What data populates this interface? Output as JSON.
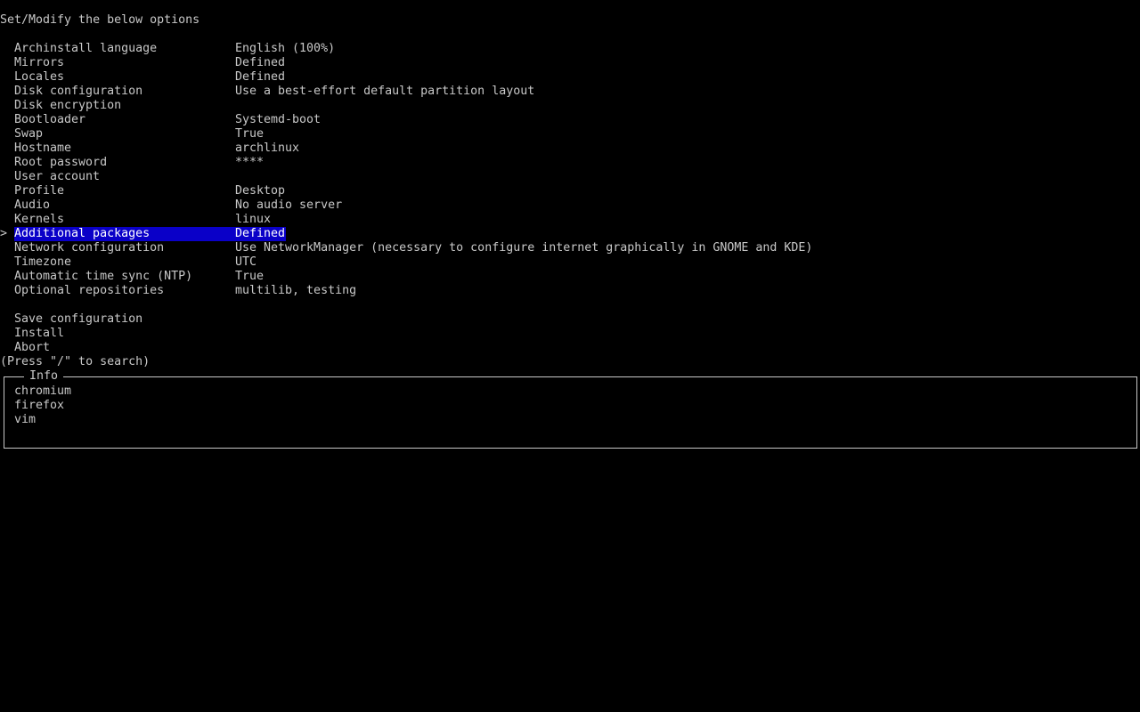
{
  "header": {
    "title": "Set/Modify the below options"
  },
  "menu": {
    "caret": ">",
    "items": [
      {
        "label": "Archinstall language",
        "value": "English (100%)"
      },
      {
        "label": "Mirrors",
        "value": "Defined"
      },
      {
        "label": "Locales",
        "value": "Defined"
      },
      {
        "label": "Disk configuration",
        "value": "Use a best-effort default partition layout"
      },
      {
        "label": "Disk encryption",
        "value": ""
      },
      {
        "label": "Bootloader",
        "value": "Systemd-boot"
      },
      {
        "label": "Swap",
        "value": "True"
      },
      {
        "label": "Hostname",
        "value": "archlinux"
      },
      {
        "label": "Root password",
        "value": "****"
      },
      {
        "label": "User account",
        "value": ""
      },
      {
        "label": "Profile",
        "value": "Desktop"
      },
      {
        "label": "Audio",
        "value": "No audio server"
      },
      {
        "label": "Kernels",
        "value": "linux"
      },
      {
        "label": "Additional packages",
        "value": "Defined",
        "selected": true
      },
      {
        "label": "Network configuration",
        "value": "Use NetworkManager (necessary to configure internet graphically in GNOME and KDE)"
      },
      {
        "label": "Timezone",
        "value": "UTC"
      },
      {
        "label": "Automatic time sync (NTP)",
        "value": "True"
      },
      {
        "label": "Optional repositories",
        "value": "multilib, testing"
      }
    ],
    "actions": [
      {
        "label": "Save configuration"
      },
      {
        "label": "Install"
      },
      {
        "label": "Abort"
      }
    ]
  },
  "search_hint": "(Press \"/\" to search)",
  "info": {
    "title": "Info",
    "lines": [
      "chromium",
      "firefox",
      "vim"
    ]
  },
  "colors": {
    "background": "#000000",
    "foreground": "#c8c8c8",
    "highlight": "#0a00c8",
    "highlight_text": "#ffffff"
  }
}
